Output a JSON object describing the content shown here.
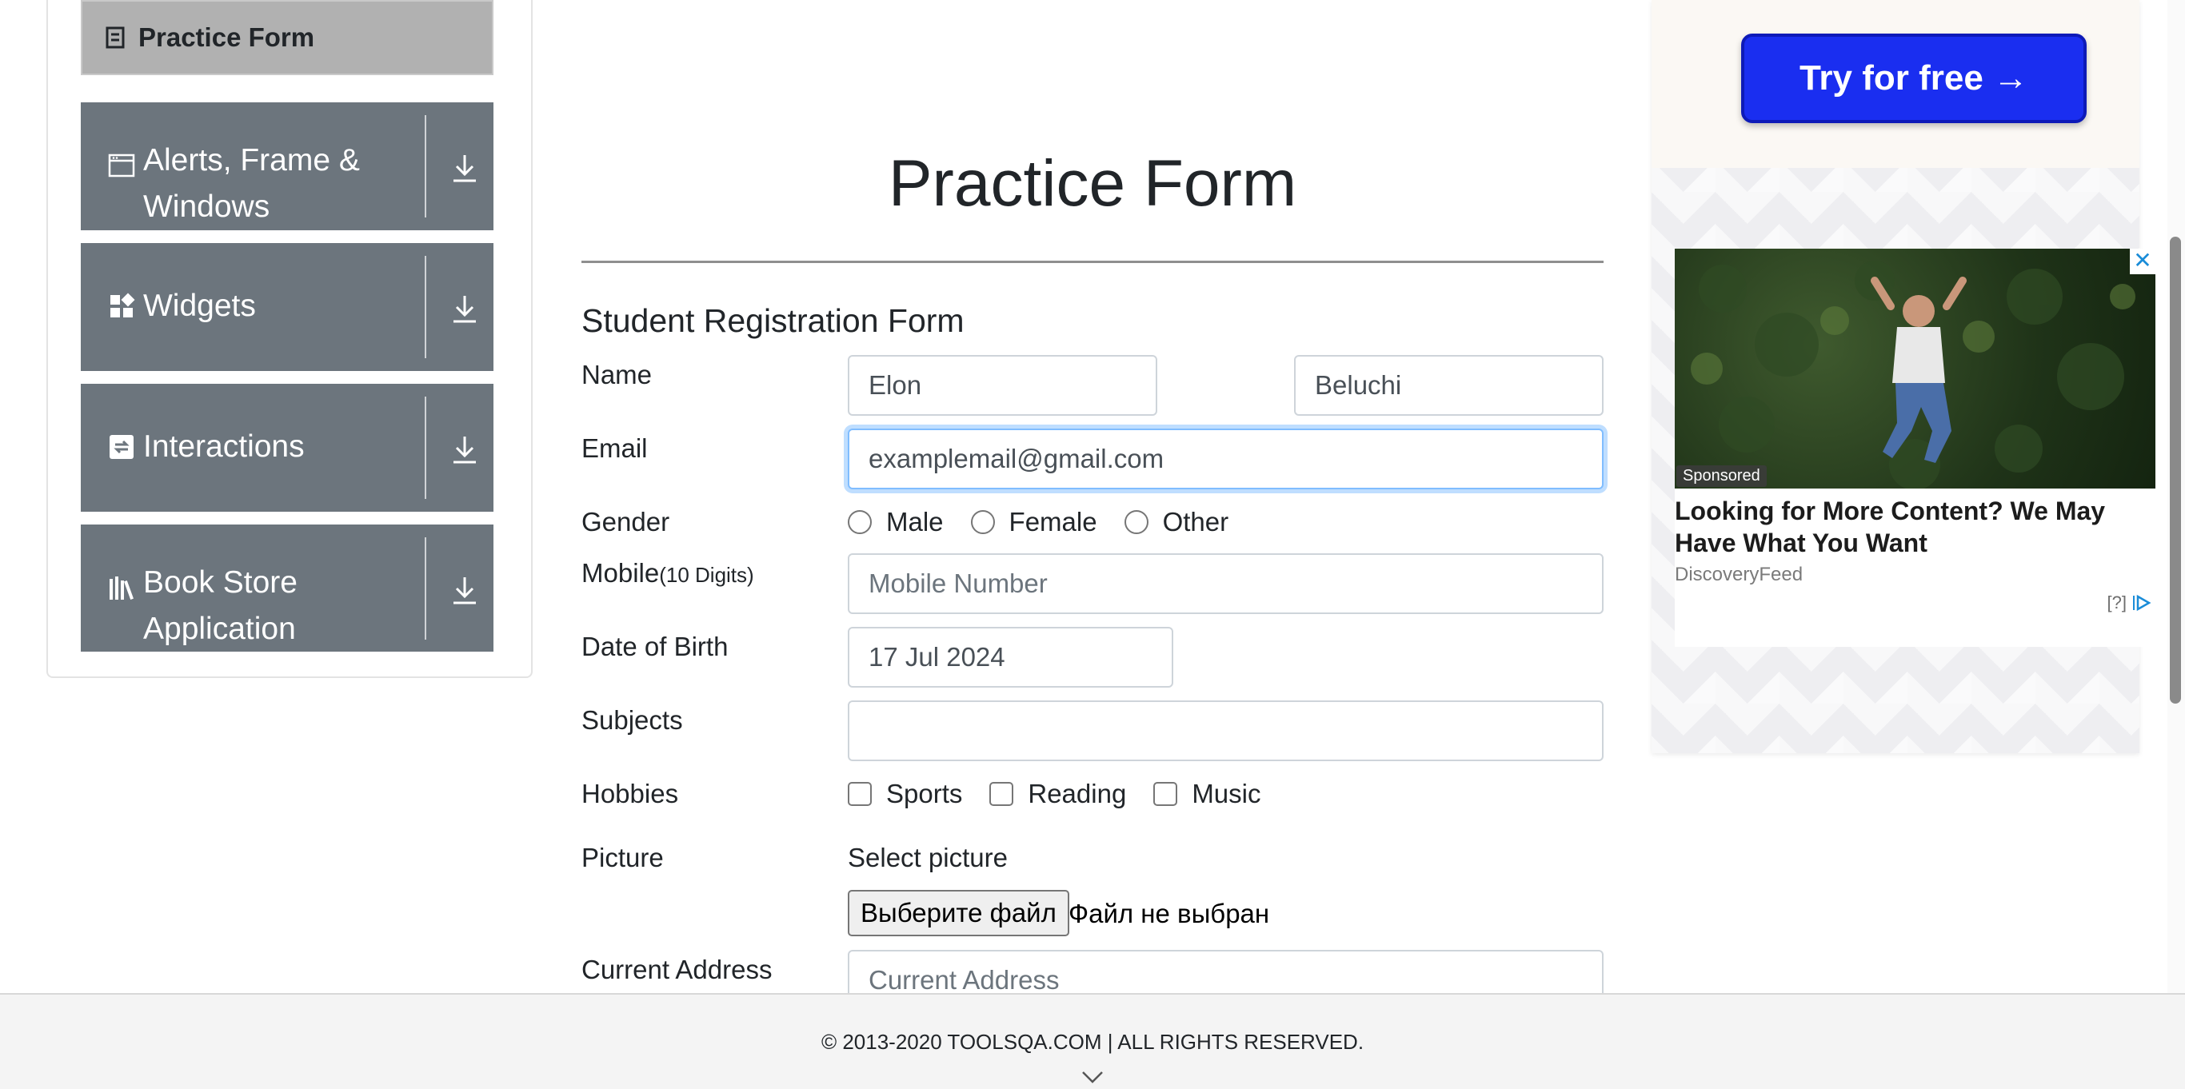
{
  "sidebar": {
    "active_item": "Practice Form",
    "groups": [
      {
        "label": "Alerts, Frame & Windows",
        "icon": "window-icon"
      },
      {
        "label": "Widgets",
        "icon": "widgets-icon"
      },
      {
        "label": "Interactions",
        "icon": "interactions-icon"
      },
      {
        "label": "Book Store Application",
        "icon": "books-icon"
      }
    ]
  },
  "main": {
    "title": "Practice Form",
    "form_heading": "Student Registration Form",
    "name": {
      "label": "Name",
      "first_value": "Elon",
      "last_value": "Beluchi"
    },
    "email": {
      "label": "Email",
      "value": "examplemail@gmail.com"
    },
    "gender": {
      "label": "Gender",
      "options": [
        "Male",
        "Female",
        "Other"
      ]
    },
    "mobile": {
      "label": "Mobile",
      "hint": "(10 Digits)",
      "placeholder": "Mobile Number"
    },
    "dob": {
      "label": "Date of Birth",
      "value": "17 Jul 2024"
    },
    "subjects": {
      "label": "Subjects",
      "value": ""
    },
    "hobbies": {
      "label": "Hobbies",
      "options": [
        "Sports",
        "Reading",
        "Music"
      ]
    },
    "picture": {
      "label": "Picture",
      "select_text": "Select picture",
      "button": "Выберите файл",
      "status": "Файл не выбран"
    },
    "address": {
      "label": "Current Address",
      "placeholder": "Current Address"
    }
  },
  "ad": {
    "cta": "Try for free →",
    "sponsored": "Sponsored",
    "headline": "Looking for More Content? We May Have What You Want",
    "source": "DiscoveryFeed",
    "choices": "[?]"
  },
  "footer": {
    "text": "© 2013-2020 TOOLSQA.COM | ALL RIGHTS RESERVED."
  },
  "colors": {
    "sidebar_group_bg": "#6c757d",
    "active_item_bg": "#b1b1b1",
    "cta_blue": "#1a2ef0",
    "focus_border": "#80bdff"
  }
}
